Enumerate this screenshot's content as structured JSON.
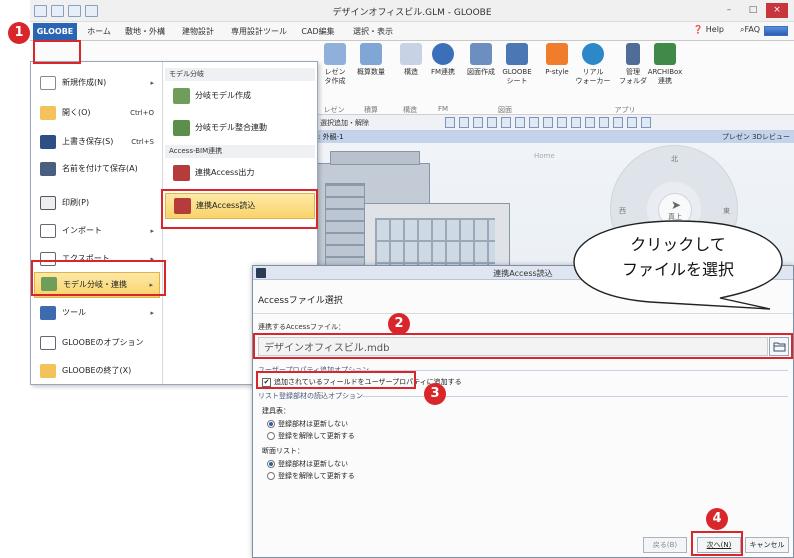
{
  "window": {
    "title": "デザインオフィスビル.GLM - GLOOBE",
    "controls": [
      "–",
      "□",
      "×"
    ]
  },
  "tabs": [
    "GLOOBE",
    "ホーム",
    "敷地・外構",
    "建物設計",
    "専用設計ツール",
    "CAD編集",
    "選択・表示"
  ],
  "help": {
    "help_label": "Help",
    "faq_label": "FAQ"
  },
  "ribbon": {
    "buttons": [
      "レゼン\nタ作成",
      "概算数量",
      "構造",
      "FM連携",
      "図面作成",
      "GLOOBE\nシート",
      "P-style",
      "リアル\nウォーカー",
      "管理\nフォルダ",
      "ARCHIBox\n連携"
    ],
    "groups": [
      "レゼン",
      "積算",
      "構造",
      "FM",
      "図面",
      "アプリ"
    ]
  },
  "cmdbar": {
    "text": "選択追加・解除"
  },
  "viewbar": {
    "label": "視点: 外観-1",
    "right": "プレゼン 3Dレビュー"
  },
  "navwheel": {
    "home": "Home",
    "north": "北",
    "south": "南",
    "east": "東",
    "west": "西",
    "center": "真上"
  },
  "menu": {
    "left_items": [
      {
        "label": "新規作成(N)",
        "shortcut": "",
        "arrow": "▸"
      },
      {
        "label": "開く(O)",
        "shortcut": "Ctrl+O",
        "arrow": ""
      },
      {
        "label": "上書き保存(S)",
        "shortcut": "Ctrl+S",
        "arrow": ""
      },
      {
        "label": "名前を付けて保存(A)",
        "shortcut": "",
        "arrow": ""
      },
      {
        "label": "印刷(P)",
        "shortcut": "",
        "arrow": ""
      },
      {
        "label": "インポート",
        "shortcut": "",
        "arrow": "▸"
      },
      {
        "label": "エクスポート",
        "shortcut": "",
        "arrow": "▸"
      },
      {
        "label": "モデル分岐・連携",
        "shortcut": "",
        "arrow": "▸"
      },
      {
        "label": "ツール",
        "shortcut": "",
        "arrow": "▸"
      },
      {
        "label": "GLOOBEのオプション",
        "shortcut": "",
        "arrow": ""
      },
      {
        "label": "GLOOBEの終了(X)",
        "shortcut": "",
        "arrow": ""
      }
    ],
    "right_header1": "モデル分岐",
    "right_items1": [
      "分岐モデル作成",
      "分岐モデル整合連動"
    ],
    "right_header2": "Access-BIM連携",
    "right_items2": [
      "連携Access出力",
      "連携Access読込"
    ]
  },
  "dialog": {
    "title": "連携Access読込",
    "heading": "Accessファイル選択",
    "file_label": "連携するAccessファイル：",
    "file_value": "デザインオフィスビル.mdb",
    "option_group": "ユーザープロパティ追加オプション",
    "option_checkbox": "追加されているフィールドをユーザープロパティに追加する",
    "option_checked": true,
    "list_group": "リスト登録部材の読込オプション",
    "sections": [
      {
        "title": "建具表：",
        "options": [
          "登録部材は更新しない",
          "登録を解除して更新する"
        ],
        "selected": 0
      },
      {
        "title": "断面リスト：",
        "options": [
          "登録部材は更新しない",
          "登録を解除して更新する"
        ],
        "selected": 0
      }
    ],
    "back_label": "戻る(B)",
    "next_label": "次へ(N)",
    "cancel_label": "キャンセル"
  },
  "callout": {
    "line1": "クリックして",
    "line2": "ファイルを選択"
  },
  "badges": [
    "1",
    "2",
    "3",
    "4"
  ],
  "colors": {
    "accent": "#2a65b4",
    "highlight": "#f9d36a",
    "annotation": "#d9262b"
  }
}
